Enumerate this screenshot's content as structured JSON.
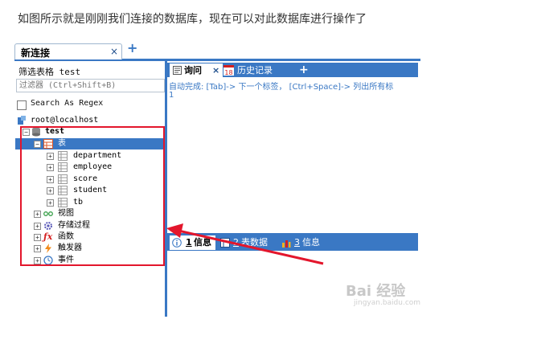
{
  "caption": "如图所示就是刚刚我们连接的数据库，现在可以对此数据库进行操作了",
  "connection_tab": {
    "label": "新连接",
    "close": "×",
    "add": "+"
  },
  "left_panel": {
    "filter_label": "筛选表格 test",
    "filter_placeholder": "过滤器 (Ctrl+Shift+B)",
    "regex_label": "Search As Regex",
    "server": "root@localhost",
    "database": "test",
    "tables_folder": "表",
    "tables": [
      "department",
      "employee",
      "score",
      "student",
      "tb"
    ],
    "other_folders": [
      "视图",
      "存储过程",
      "函数",
      "触发器",
      "事件"
    ]
  },
  "query_tabs": {
    "query": "询问",
    "history": "历史记录",
    "history_badge": "18",
    "add": "+"
  },
  "editor": {
    "autocomplete_hint": "自动完成: [Tab]-> 下一个标签， [Ctrl+Space]-> 列出所有标",
    "line_number": "1"
  },
  "result_tabs": {
    "info1_num": "1",
    "info1_label": "信息",
    "table_num": "2",
    "table_label": "表数据",
    "info3_num": "3",
    "info3_label": "信息"
  },
  "watermark": {
    "main": "Bai 经验",
    "sub": "jingyan.baidu.com"
  },
  "colors": {
    "accent": "#3a78c4",
    "highlight": "#e3162c"
  }
}
